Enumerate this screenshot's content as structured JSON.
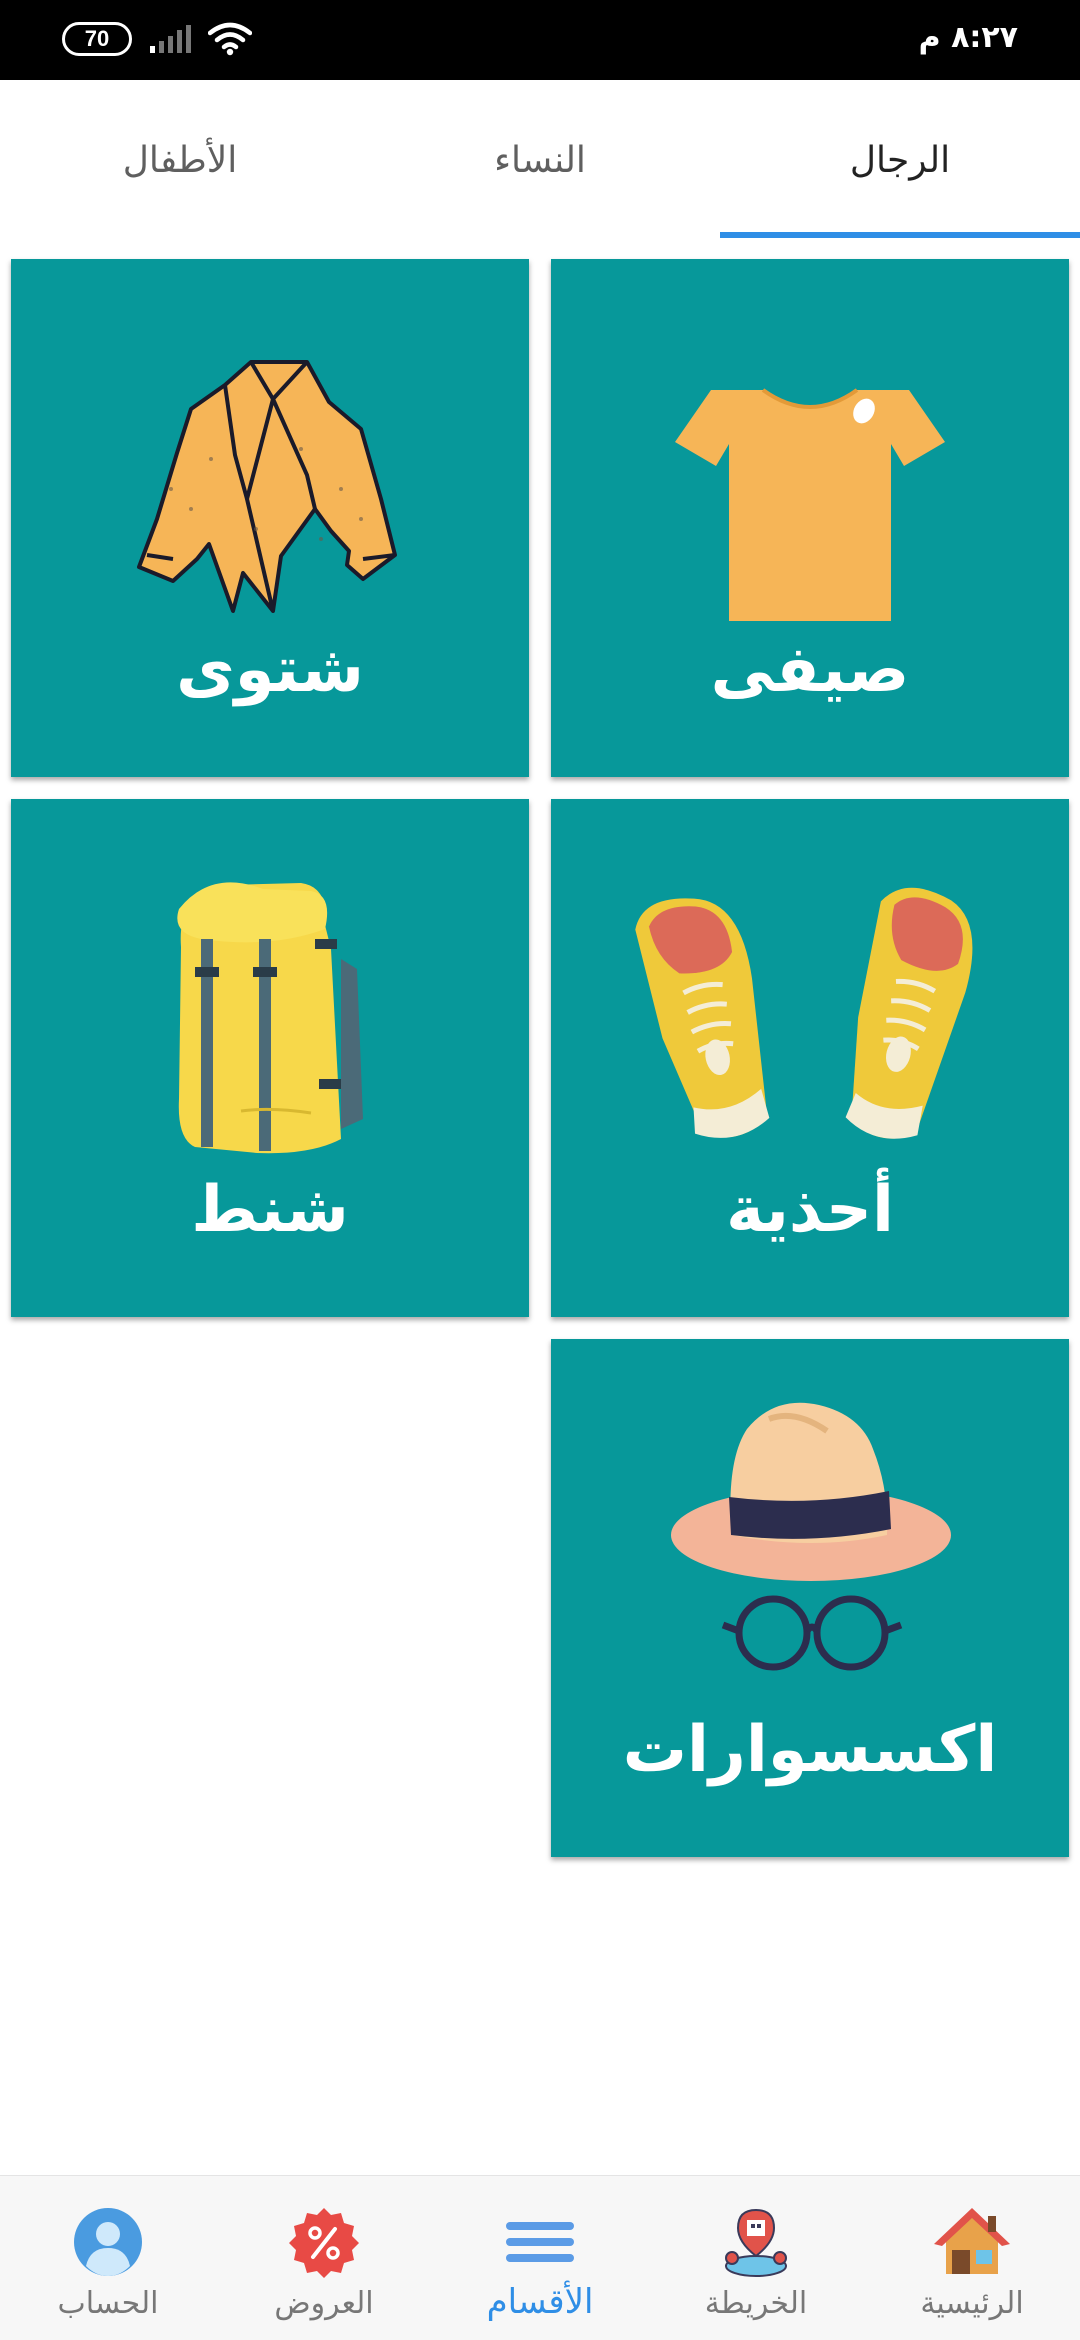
{
  "status_bar": {
    "time": "٨:٢٧ م",
    "battery": "70",
    "icons": [
      "battery-icon",
      "signal-icon",
      "wifi-icon"
    ]
  },
  "tabs": [
    {
      "label": "الرجال",
      "active": true
    },
    {
      "label": "النساء",
      "active": false
    },
    {
      "label": "الأطفال",
      "active": false
    }
  ],
  "categories": [
    {
      "label": "صيفى",
      "icon": "tshirt-icon"
    },
    {
      "label": "شتوى",
      "icon": "jacket-icon"
    },
    {
      "label": "أحذية",
      "icon": "sneakers-icon"
    },
    {
      "label": "شنط",
      "icon": "backpack-icon"
    },
    {
      "label": "اكسسوارات",
      "icon": "hat-glasses-icon"
    }
  ],
  "bottom_nav": [
    {
      "label": "الرئيسية",
      "icon": "home-icon",
      "active": false
    },
    {
      "label": "الخريطة",
      "icon": "map-icon",
      "active": false
    },
    {
      "label": "الأقسام",
      "icon": "menu-icon",
      "active": true
    },
    {
      "label": "العروض",
      "icon": "discount-icon",
      "active": false
    },
    {
      "label": "الحساب",
      "icon": "user-icon",
      "active": false
    }
  ],
  "colors": {
    "tile": "#07989a",
    "accent": "#2f8ee6",
    "status_bar": "#000000"
  }
}
